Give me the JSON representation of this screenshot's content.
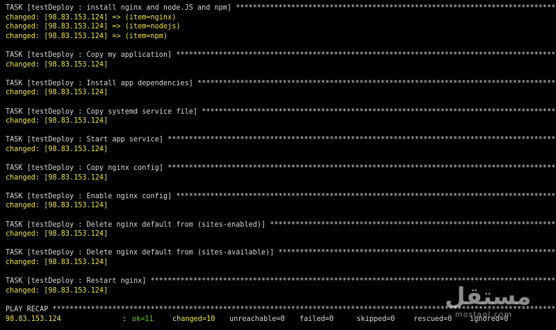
{
  "tasks": [
    {
      "header": "TASK [testDeploy : install nginx and node.JS and npm] ****************************************************************************************************",
      "results": [
        "changed: [98.83.153.124] => (item=nginx)",
        "changed: [98.83.153.124] => (item=nodejs)",
        "changed: [98.83.153.124] => (item=npm)"
      ]
    },
    {
      "header": "TASK [testDeploy : Copy my application] ****************************************************************************************************",
      "results": [
        "changed: [98.83.153.124]"
      ]
    },
    {
      "header": "TASK [testDeploy : Install app dependencies] ****************************************************************************************************",
      "results": [
        "changed: [98.83.153.124]"
      ]
    },
    {
      "header": "TASK [testDeploy : Copy systemd service file] ****************************************************************************************************",
      "results": [
        "changed: [98.83.153.124]"
      ]
    },
    {
      "header": "TASK [testDeploy : Start app service] ****************************************************************************************************",
      "results": [
        "changed: [98.83.153.124]"
      ]
    },
    {
      "header": "TASK [testDeploy : Copy nginx config] ****************************************************************************************************",
      "results": [
        "changed: [98.83.153.124]"
      ]
    },
    {
      "header": "TASK [testDeploy : Enable nginx config] ****************************************************************************************************",
      "results": [
        "changed: [98.83.153.124]"
      ]
    },
    {
      "header": "TASK [testDeploy : Delete nginx default from (sites-enabled)] ****************************************************************************************************",
      "results": [
        "changed: [98.83.153.124]"
      ]
    },
    {
      "header": "TASK [testDeploy : Delete nginx default from (sites-available)] ****************************************************************************************************",
      "results": [
        "changed: [98.83.153.124]"
      ]
    },
    {
      "header": "TASK [testDeploy : Restart nginx] ****************************************************************************************************",
      "results": [
        "changed: [98.83.153.124]"
      ]
    }
  ],
  "recap": {
    "title": "PLAY RECAP ****************************************************************************************************************************************",
    "host": "98.83.153.124",
    "colon": ":",
    "ok": "ok=11",
    "changed": "changed=10",
    "unreachable": "unreachable=0",
    "failed": "failed=0",
    "skipped": "skipped=0",
    "rescued": "rescued=0",
    "ignored": "ignored=0"
  },
  "watermark": {
    "arabic": "مستقل",
    "latin": "mostaql.com"
  },
  "colors": {
    "background": "#000000",
    "task_text": "#d7d7d7",
    "changed_text": "#f0e442",
    "ok_text": "#5fd700"
  }
}
